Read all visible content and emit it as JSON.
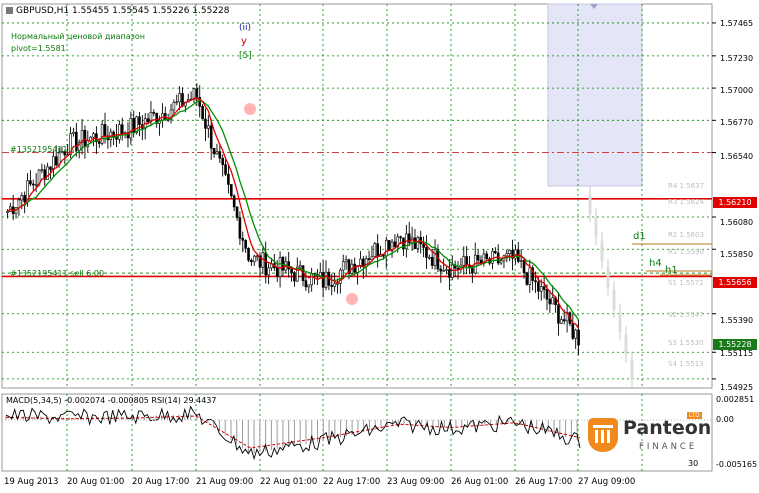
{
  "chart_header": {
    "symbol": "GBPUSD,H1",
    "ohlc": "1.55455 1.55545 1.55226 1.55228",
    "indicator_name": "Нормальный ценовой диапазон",
    "pivot": "pivot=1.5581"
  },
  "wave_labels": {
    "count": "(ii)",
    "letter": "y",
    "sub": "[5]"
  },
  "orders": {
    "buy_label": "#1352195411 sl",
    "sell_label": "#1352195411 sell 6.00"
  },
  "levels": {
    "d1": "d1",
    "h4": "h4",
    "h1": "h1"
  },
  "pivot_labels": [
    "R4 1.5637",
    "R3 1.5624",
    "R2 1.5603",
    "R1 1.5590",
    "S1 1.5572",
    "S2 1.5547",
    "S3 1.5530",
    "S4 1.5513"
  ],
  "y_ticks": [
    "1.57465",
    "1.57230",
    "1.57000",
    "1.56770",
    "1.56540",
    "1.56080",
    "1.55850",
    "1.55390",
    "1.55115",
    "1.54925"
  ],
  "price_badges": {
    "red_upper": "1.56210",
    "red_lower": "1.55656",
    "current": "1.55228"
  },
  "x_labels": [
    "19 Aug 2013",
    "20 Aug 01:00",
    "20 Aug 17:00",
    "21 Aug 09:00",
    "22 Aug 01:00",
    "22 Aug 17:00",
    "23 Aug 09:00",
    "26 Aug 01:00",
    "26 Aug 17:00",
    "27 Aug 09:00"
  ],
  "sub_header": "MACD(5,34,5) -0.002074 -0.000805 RSI(14) 29.4437",
  "sub_ticks": [
    "0.002851",
    "0.00",
    "-0.005165"
  ],
  "sub_rsi_ticks": [
    "30"
  ],
  "logo": {
    "brand": "Panteon",
    "sub": "FINANCE",
    "badge": "LTD"
  },
  "colors": {
    "price_up": "#000000",
    "ma_fast": "#e00000",
    "ma_slow": "#009000",
    "level_red": "#e00000",
    "grid": "#008800",
    "forecast": "#c8c8c8",
    "zone": "#e4e6f7",
    "logo_orange": "#f08a1c"
  },
  "chart_data": [
    {
      "type": "candlestick",
      "title": "GBPUSD,H1",
      "ylim": [
        1.5486,
        1.576
      ],
      "grid": true,
      "note": "approximate mid/close path read from the chart",
      "x": [
        "19 Aug 2013",
        "20 Aug 01:00",
        "20 Aug 17:00",
        "21 Aug 09:00",
        "22 Aug 01:00",
        "22 Aug 17:00",
        "23 Aug 09:00",
        "26 Aug 01:00",
        "26 Aug 17:00",
        "27 Aug 09:00"
      ],
      "series": [
        {
          "values": [
            1.5612,
            1.566,
            1.5672,
            1.5695,
            1.5578,
            1.5562,
            1.5595,
            1.5572,
            1.5578,
            1.5522
          ]
        }
      ],
      "horizontal_levels": [
        1.5621,
        1.55656,
        1.5654,
        1.5568
      ],
      "pivot": 1.5581
    },
    {
      "type": "line",
      "title": "MACD(5,34,5) -0.002074 -0.000805 RSI(14) 29.4437",
      "ylim": [
        -0.005165,
        0.002851
      ],
      "x": [
        "19 Aug 2013",
        "20 Aug 01:00",
        "20 Aug 17:00",
        "21 Aug 09:00",
        "22 Aug 01:00",
        "22 Aug 17:00",
        "23 Aug 09:00",
        "26 Aug 01:00",
        "26 Aug 17:00",
        "27 Aug 09:00"
      ],
      "series": [
        {
          "values": [
            0.001,
            0.0008,
            0.0009,
            0.0012,
            -0.0035,
            -0.002,
            0.0,
            -0.0005,
            0.0002,
            -0.002
          ]
        }
      ]
    }
  ]
}
